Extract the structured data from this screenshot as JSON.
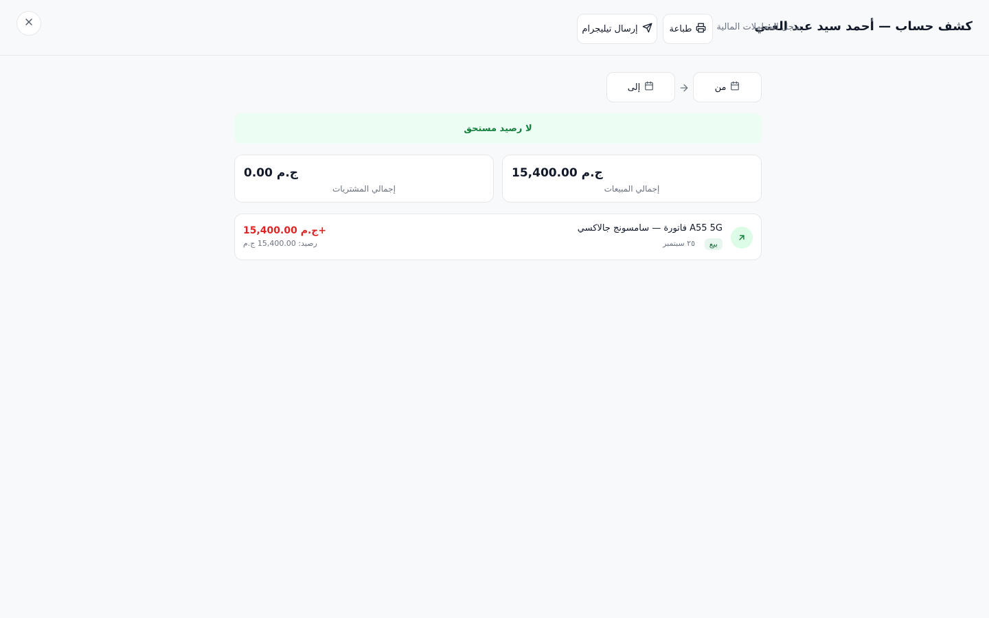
{
  "header": {
    "title": "كشف حساب — أحمد سيد عبد الغني",
    "subtitle": "سجل المعاملات المالية",
    "print_label": "طباعة",
    "telegram_label": "إرسال تيليجرام"
  },
  "date_range": {
    "from_label": "من",
    "to_label": "إلى"
  },
  "status_banner": {
    "text": "لا رصيد مستحق",
    "color": "#15803d",
    "background": "#ecfdf3"
  },
  "summary": {
    "sales": {
      "value": "ج.م 15,400.00",
      "label": "إجمالي المبيعات"
    },
    "purchases": {
      "value": "ج.م 0.00",
      "label": "إجمالي المشتريات"
    }
  },
  "transactions": [
    {
      "title": "فاتورة — سامسونج جالاكسي A55 5G",
      "type_badge": "بيع",
      "date": "٢٥ سبتمبر",
      "amount": "ج.م 15,400.00+",
      "balance": "رصيد: 15,400.00 ج.م",
      "amount_color": "#dc2626",
      "icon": "arrow-up-right-icon"
    }
  ],
  "colors": {
    "accent_green": "#15803d",
    "negative_red": "#dc2626",
    "border": "#e5e7eb",
    "background": "#f8f9fa"
  }
}
